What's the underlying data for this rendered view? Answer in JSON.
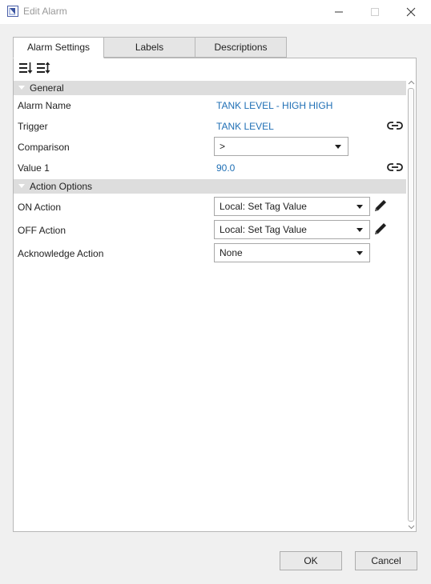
{
  "window": {
    "title": "Edit Alarm"
  },
  "tabs": [
    {
      "label": "Alarm Settings",
      "active": true
    },
    {
      "label": "Labels",
      "active": false
    },
    {
      "label": "Descriptions",
      "active": false
    }
  ],
  "toolbar": {
    "icons": [
      "sort-categorized-icon",
      "sort-alphabetical-icon"
    ]
  },
  "general": {
    "header": "General",
    "alarm_name": {
      "label": "Alarm Name",
      "value": "TANK LEVEL - HIGH HIGH"
    },
    "trigger": {
      "label": "Trigger",
      "value": "TANK LEVEL"
    },
    "comparison": {
      "label": "Comparison",
      "value": ">"
    },
    "value1": {
      "label": "Value 1",
      "value": "90.0"
    }
  },
  "action_options": {
    "header": "Action Options",
    "on_action": {
      "label": "ON Action",
      "value": "Local: Set Tag Value"
    },
    "off_action": {
      "label": "OFF Action",
      "value": "Local: Set Tag Value"
    },
    "ack_action": {
      "label": "Acknowledge Action",
      "value": "None"
    }
  },
  "buttons": {
    "ok": "OK",
    "cancel": "Cancel"
  },
  "colors": {
    "link_value": "#1f6fb5",
    "category_bg": "#dddddd",
    "dialog_bg": "#f0f0f0"
  }
}
